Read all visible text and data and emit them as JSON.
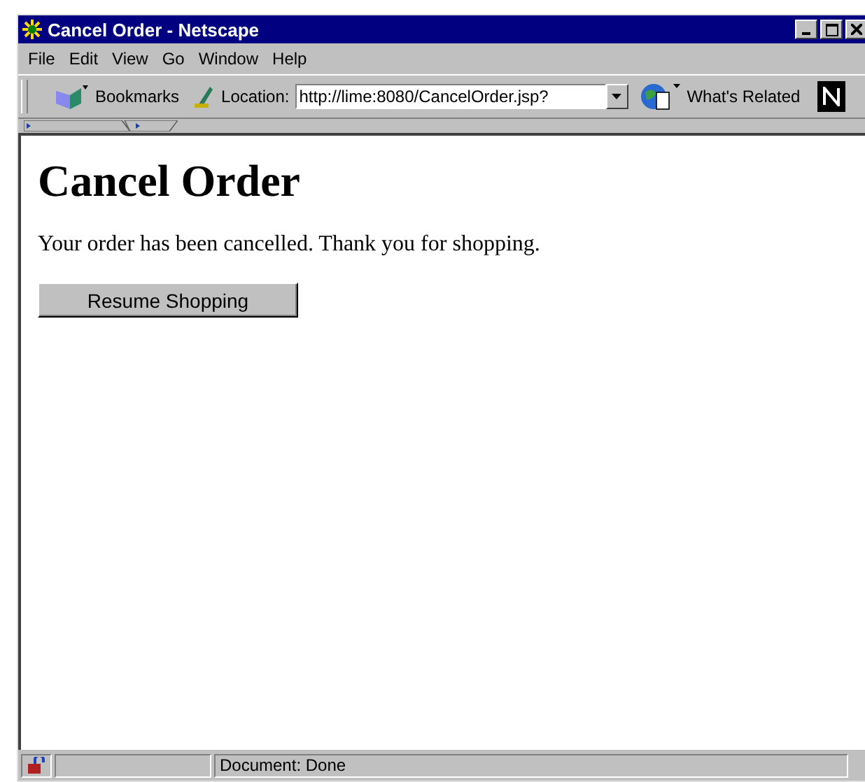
{
  "window": {
    "title": "Cancel Order - Netscape"
  },
  "menu": [
    "File",
    "Edit",
    "View",
    "Go",
    "Window",
    "Help"
  ],
  "toolbar": {
    "bookmarks": "Bookmarks",
    "location_label": "Location:",
    "location_value": "http://lime:8080/CancelOrder.jsp?",
    "related": "What's Related"
  },
  "page": {
    "heading": "Cancel Order",
    "message": "Your order has been cancelled. Thank you for shopping.",
    "button": "Resume Shopping"
  },
  "status_bar": {
    "text": "Document: Done"
  }
}
